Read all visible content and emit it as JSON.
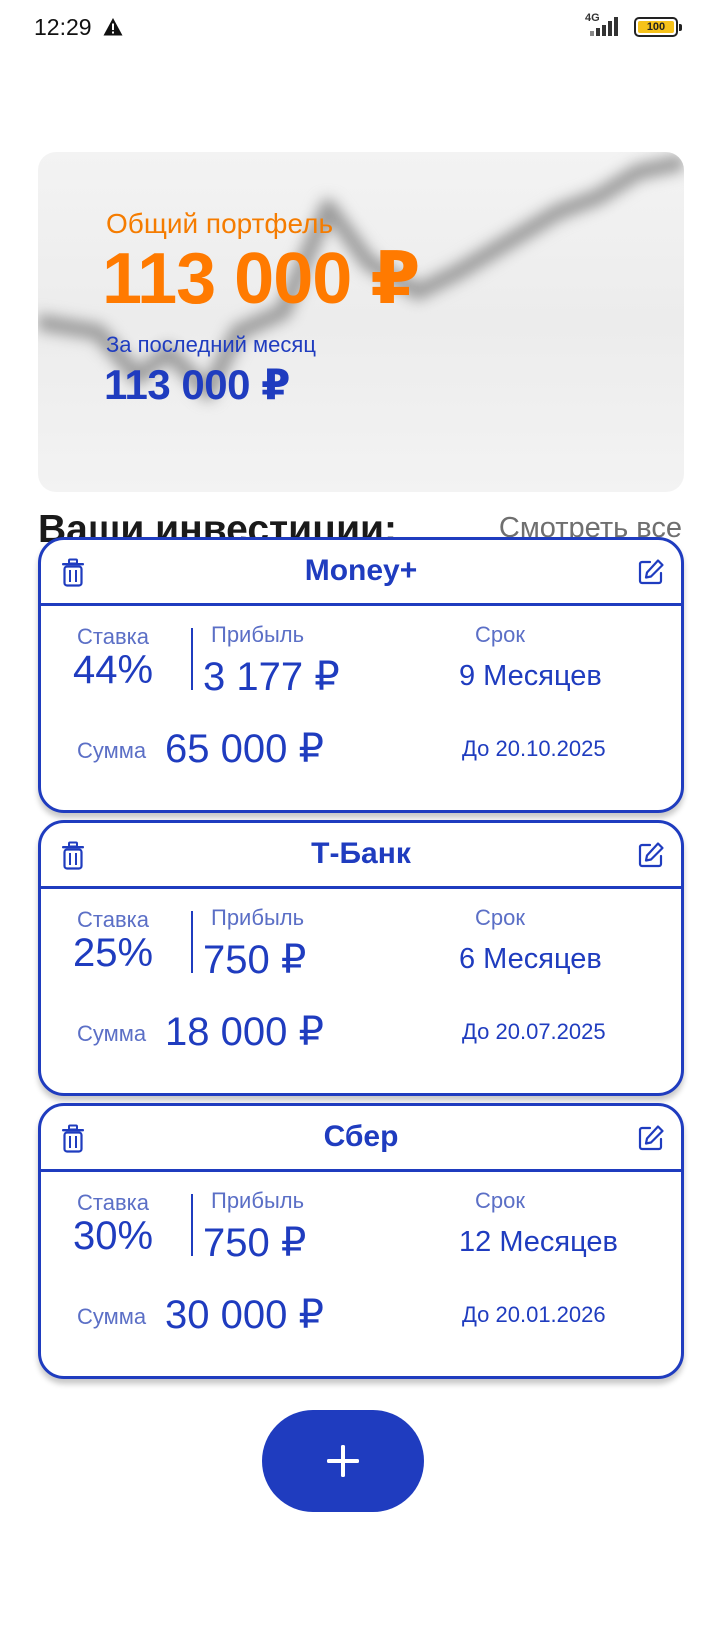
{
  "status_bar": {
    "time": "12:29",
    "network": "4G",
    "battery": "100",
    "icons": [
      "warning-icon",
      "signal-icon",
      "battery-icon"
    ]
  },
  "portfolio": {
    "title": "Общий портфель",
    "total": "113 000 ₽",
    "last_month_label": "За последний месяц",
    "last_month_value": "113 000 ₽"
  },
  "investments_section": {
    "title": "Ваши инвестиции:",
    "see_all": "Смотреть все"
  },
  "labels": {
    "rate": "Ставка",
    "profit": "Прибыль",
    "term": "Срок",
    "sum": "Сумма"
  },
  "investments": [
    {
      "name": "Money+",
      "rate": "44%",
      "profit": "3 177 ₽",
      "term": "9 Месяцев",
      "sum": "65 000 ₽",
      "until": "До 20.10.2025"
    },
    {
      "name": "Т-Банк",
      "rate": "25%",
      "profit": "750 ₽",
      "term": "6 Месяцев",
      "sum": "18 000 ₽",
      "until": "До 20.07.2025"
    },
    {
      "name": "Сбер",
      "rate": "30%",
      "profit": "750 ₽",
      "term": "12 Месяцев",
      "sum": "30 000 ₽",
      "until": "До 20.01.2026"
    }
  ],
  "fab": {
    "icon": "plus-icon"
  },
  "colors": {
    "primary": "#1f3cbf",
    "accent": "#ff7a00",
    "muted_label": "#5b6fc6",
    "see_all": "#6f6f6f"
  }
}
